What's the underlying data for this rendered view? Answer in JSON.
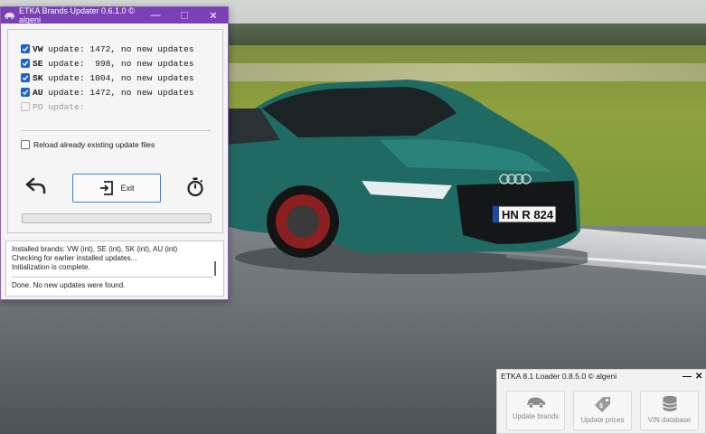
{
  "updater": {
    "title": "ETKA Brands Updater 0.6.1.0 © algeni",
    "controls": {
      "minimize": "—",
      "maximize": "☐",
      "close": "✕"
    },
    "brands": [
      {
        "code": "VW",
        "text": " update: 1472, no new updates",
        "checked": true,
        "enabled": true
      },
      {
        "code": "SE",
        "text": " update:  998, no new updates",
        "checked": true,
        "enabled": true
      },
      {
        "code": "SK",
        "text": " update: 1004, no new updates",
        "checked": true,
        "enabled": true
      },
      {
        "code": "AU",
        "text": " update: 1472, no new updates",
        "checked": true,
        "enabled": true
      },
      {
        "code": "PO",
        "text": " update:",
        "checked": false,
        "enabled": false
      }
    ],
    "reload_label": "Reload already existing update files",
    "reload_checked": false,
    "exit_label": "Exit",
    "progress_percent": 0,
    "log": [
      "Installed brands: VW (int), SE (int), SK (int), AU (int)",
      "Checking for earlier installed updates...",
      "Initialization is complete.",
      "Done. No new updates were found."
    ]
  },
  "loader": {
    "title": "ETKA 8.1 Loader 0.8.5.0 © algeni",
    "minimize": "—",
    "close": "✕",
    "tiles": [
      {
        "label": "Update brands",
        "icon": "car-icon"
      },
      {
        "label": "Update prices",
        "icon": "price-tag-icon"
      },
      {
        "label": "VIN database",
        "icon": "database-icon"
      }
    ]
  },
  "wallpaper": {
    "plate_text": "HN R 824",
    "car_color": "#1f6b63"
  }
}
